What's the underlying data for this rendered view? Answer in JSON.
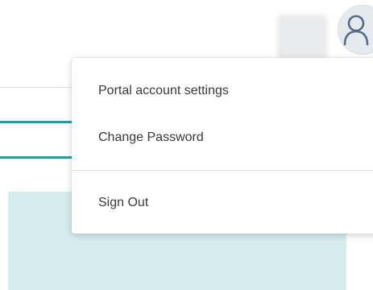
{
  "header": {
    "avatar_icon": "user-icon",
    "user_name": ""
  },
  "account_menu": {
    "items": [
      {
        "label": "Portal account settings"
      },
      {
        "label": "Change Password"
      },
      {
        "label": "Sign Out"
      }
    ]
  },
  "colors": {
    "accent": "#1aa3a3",
    "panel_background": "#d6ecee"
  }
}
